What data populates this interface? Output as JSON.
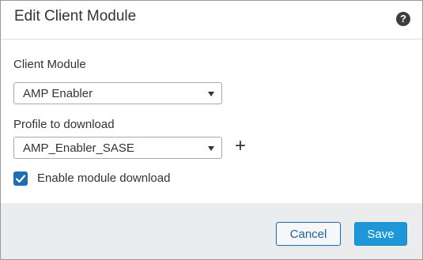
{
  "dialog": {
    "title": "Edit Client Module",
    "help_icon": "?"
  },
  "form": {
    "client_module": {
      "label": "Client Module",
      "value": "AMP Enabler"
    },
    "profile": {
      "label": "Profile to download",
      "value": "AMP_Enabler_SASE",
      "add_icon": "+"
    },
    "enable_download": {
      "label": "Enable module download",
      "checked": true
    }
  },
  "footer": {
    "cancel_label": "Cancel",
    "save_label": "Save"
  },
  "colors": {
    "checkbox": "#1f6eb3",
    "save_button": "#1e96d8",
    "cancel_border": "#2f6da8",
    "footer_bg": "#eaeced"
  }
}
